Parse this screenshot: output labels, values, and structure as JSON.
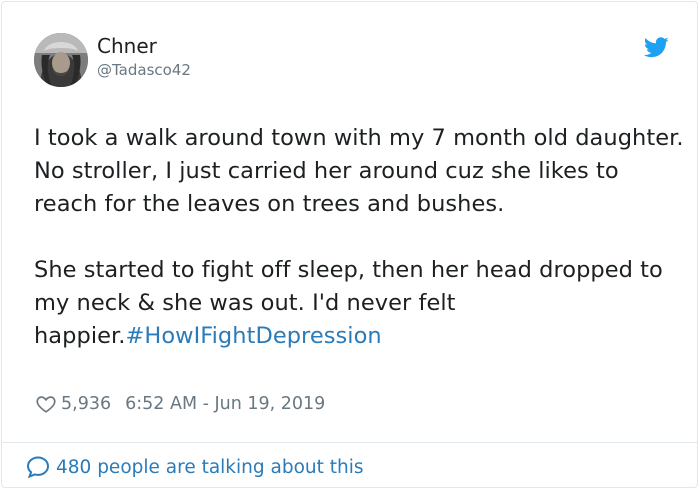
{
  "user": {
    "name": "Chner",
    "handle": "@Tadasco42"
  },
  "tweet": {
    "paragraph1": "I took a walk around town with my 7 month old daughter. No stroller, I just carried her around cuz she likes to reach for the leaves on trees and bushes.",
    "paragraph2_text": "She started to fight off sleep, then her head dropped to my neck & she was out. I'd never felt happier.",
    "hashtag": "#HowIFightDepression"
  },
  "meta": {
    "like_count": "5,936",
    "timestamp": "6:52 AM - Jun 19, 2019"
  },
  "footer": {
    "talking_text": "480 people are talking about this"
  },
  "colors": {
    "link": "#2b7bb9",
    "twitter_blue": "#1da1f2",
    "muted": "#697882",
    "text": "#1c2022",
    "border": "#e1e8ed"
  },
  "icons": {
    "brand": "twitter-bird-icon",
    "like": "heart-icon",
    "reply": "speech-bubble-icon"
  }
}
